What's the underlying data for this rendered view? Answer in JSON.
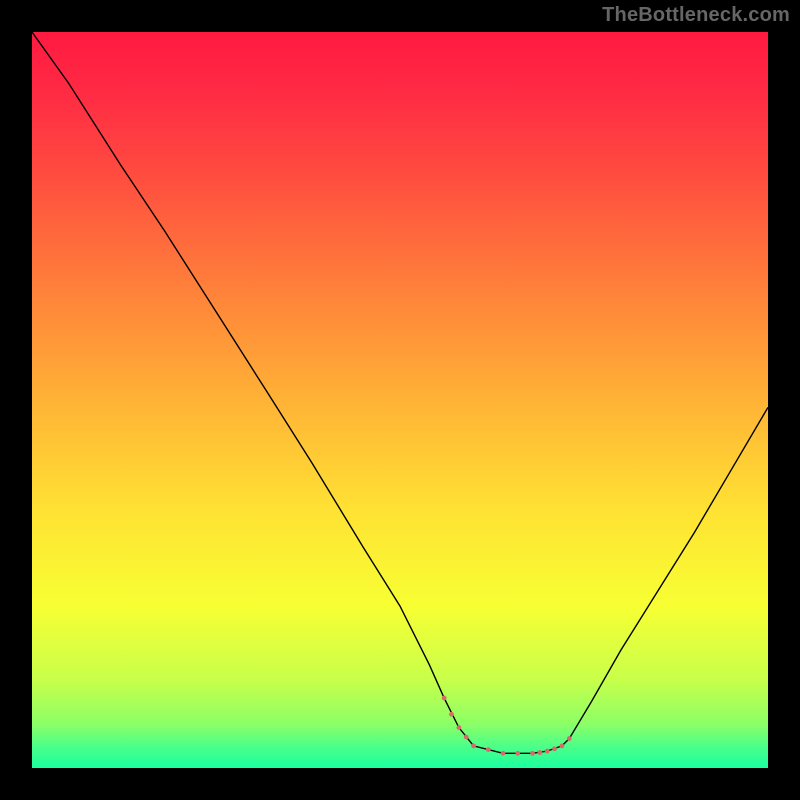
{
  "watermark": "TheBottleneck.com",
  "chart_data": {
    "type": "line",
    "title": "",
    "xlabel": "",
    "ylabel": "",
    "xlim": [
      0,
      100
    ],
    "ylim": [
      0,
      100
    ],
    "curve_x": [
      0,
      5,
      12,
      18,
      25,
      32,
      38,
      45,
      50,
      54,
      56,
      58,
      60,
      64,
      68,
      70,
      72,
      73,
      76,
      80,
      85,
      90,
      95,
      100
    ],
    "curve_y": [
      100,
      93,
      82,
      73,
      62,
      51,
      41.5,
      30,
      22,
      14,
      9.5,
      5.5,
      3,
      2,
      2,
      2.3,
      3,
      4,
      9,
      16,
      24,
      32,
      40.5,
      49
    ],
    "flat_zone_x": [
      56,
      57,
      58,
      59,
      60,
      62,
      64,
      66,
      68,
      69,
      70,
      71,
      72,
      73
    ],
    "flat_zone_y": [
      9.5,
      7.3,
      5.5,
      4.2,
      3,
      2.5,
      2,
      2,
      2,
      2.1,
      2.3,
      2.6,
      3,
      4
    ],
    "marker_radius": 2.4,
    "gradient_stops": [
      {
        "offset": 0.0,
        "color": "#ff1a40"
      },
      {
        "offset": 0.08,
        "color": "#ff2a44"
      },
      {
        "offset": 0.2,
        "color": "#ff4e3f"
      },
      {
        "offset": 0.35,
        "color": "#ff813a"
      },
      {
        "offset": 0.5,
        "color": "#ffb236"
      },
      {
        "offset": 0.65,
        "color": "#ffe233"
      },
      {
        "offset": 0.78,
        "color": "#f7ff33"
      },
      {
        "offset": 0.88,
        "color": "#c8ff4a"
      },
      {
        "offset": 0.94,
        "color": "#8cff66"
      },
      {
        "offset": 0.97,
        "color": "#4dff88"
      },
      {
        "offset": 1.0,
        "color": "#1aff9f"
      }
    ],
    "line_color": "#000000",
    "marker_color": "#d86a6a"
  }
}
